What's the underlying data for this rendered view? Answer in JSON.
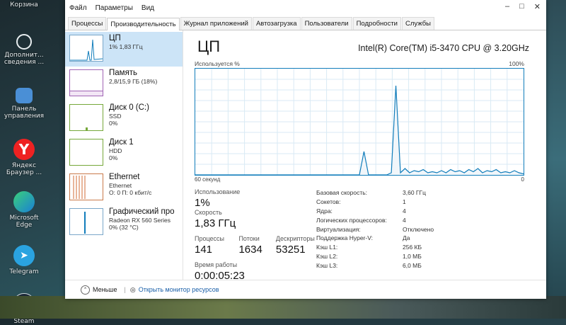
{
  "desktop": {
    "items": [
      {
        "label": "Корзина"
      },
      {
        "label": "Дополнит... сведения ..."
      },
      {
        "label": "Панель управления"
      },
      {
        "label": "Яндекс Браузер ..."
      },
      {
        "label": "Microsoft Edge"
      },
      {
        "label": "Telegram"
      },
      {
        "label": "Steam"
      }
    ]
  },
  "menu": {
    "items": [
      "Файл",
      "Параметры",
      "Вид"
    ]
  },
  "tabs": [
    {
      "label": "Процессы"
    },
    {
      "label": "Производительность"
    },
    {
      "label": "Журнал приложений"
    },
    {
      "label": "Автозагрузка"
    },
    {
      "label": "Пользователи"
    },
    {
      "label": "Подробности"
    },
    {
      "label": "Службы"
    }
  ],
  "sidebar": {
    "items": [
      {
        "title": "ЦП",
        "line1": "1% 1,83 ГГц",
        "line2": ""
      },
      {
        "title": "Память",
        "line1": "2,8/15,9 ГБ (18%)",
        "line2": ""
      },
      {
        "title": "Диск 0 (C:)",
        "line1": "SSD",
        "line2": "0%"
      },
      {
        "title": "Диск 1",
        "line1": "HDD",
        "line2": "0%"
      },
      {
        "title": "Ethernet",
        "line1": "Ethernet",
        "line2": "О: 0 П: 0 кбит/с"
      },
      {
        "title": "Графический про",
        "line1": "Radeon RX 560 Series",
        "line2": "0% (32 °C)"
      }
    ]
  },
  "main": {
    "title": "ЦП",
    "cpu_model": "Intel(R) Core(TM) i5-3470 CPU @ 3.20GHz",
    "graph_top_left": "Используется %",
    "graph_top_right": "100%",
    "graph_bottom_left": "60 секунд",
    "graph_bottom_right": "0",
    "usage_series": [
      0,
      0,
      0,
      0,
      0,
      0,
      0,
      0,
      0,
      0,
      0,
      0,
      0,
      0,
      0,
      0,
      0,
      0,
      0,
      0,
      0,
      0,
      0,
      0,
      0,
      0,
      0,
      0,
      0,
      0,
      0,
      0,
      0,
      0,
      0,
      0,
      0,
      22,
      0,
      0,
      0,
      0,
      0,
      2,
      84,
      2,
      6,
      2,
      4,
      3,
      5,
      2,
      3,
      2,
      4,
      2,
      5,
      3,
      4,
      2,
      5,
      3,
      6,
      2,
      4,
      3,
      5,
      2,
      3,
      2,
      4,
      2,
      1
    ]
  },
  "stats": {
    "usage_label": "Использование",
    "usage_value": "1%",
    "speed_label": "Скорость",
    "speed_value": "1,83 ГГц",
    "processes_label": "Процессы",
    "processes_value": "141",
    "threads_label": "Потоки",
    "threads_value": "1634",
    "handles_label": "Дескрипторы",
    "handles_value": "53251",
    "uptime_label": "Время работы",
    "uptime_value": "0:00:05:23"
  },
  "specs": [
    {
      "k": "Базовая скорость:",
      "v": "3,60 ГГц"
    },
    {
      "k": "Сокетов:",
      "v": "1"
    },
    {
      "k": "Ядра:",
      "v": "4"
    },
    {
      "k": "Логических процессоров:",
      "v": "4"
    },
    {
      "k": "Виртуализация:",
      "v": "Отключено"
    },
    {
      "k": "Поддержка Hyper-V:",
      "v": "Да"
    },
    {
      "k": "Кэш L1:",
      "v": "256 КБ"
    },
    {
      "k": "Кэш L2:",
      "v": "1,0 МБ"
    },
    {
      "k": "Кэш L3:",
      "v": "6,0 МБ"
    }
  ],
  "footer": {
    "less": "Меньше",
    "monitor": "Открыть монитор ресурсов"
  },
  "colors": {
    "accent": "#117dbb",
    "fill": "#f1f6fa",
    "grid": "#d9eaf4",
    "selected": "#cce4f7"
  }
}
